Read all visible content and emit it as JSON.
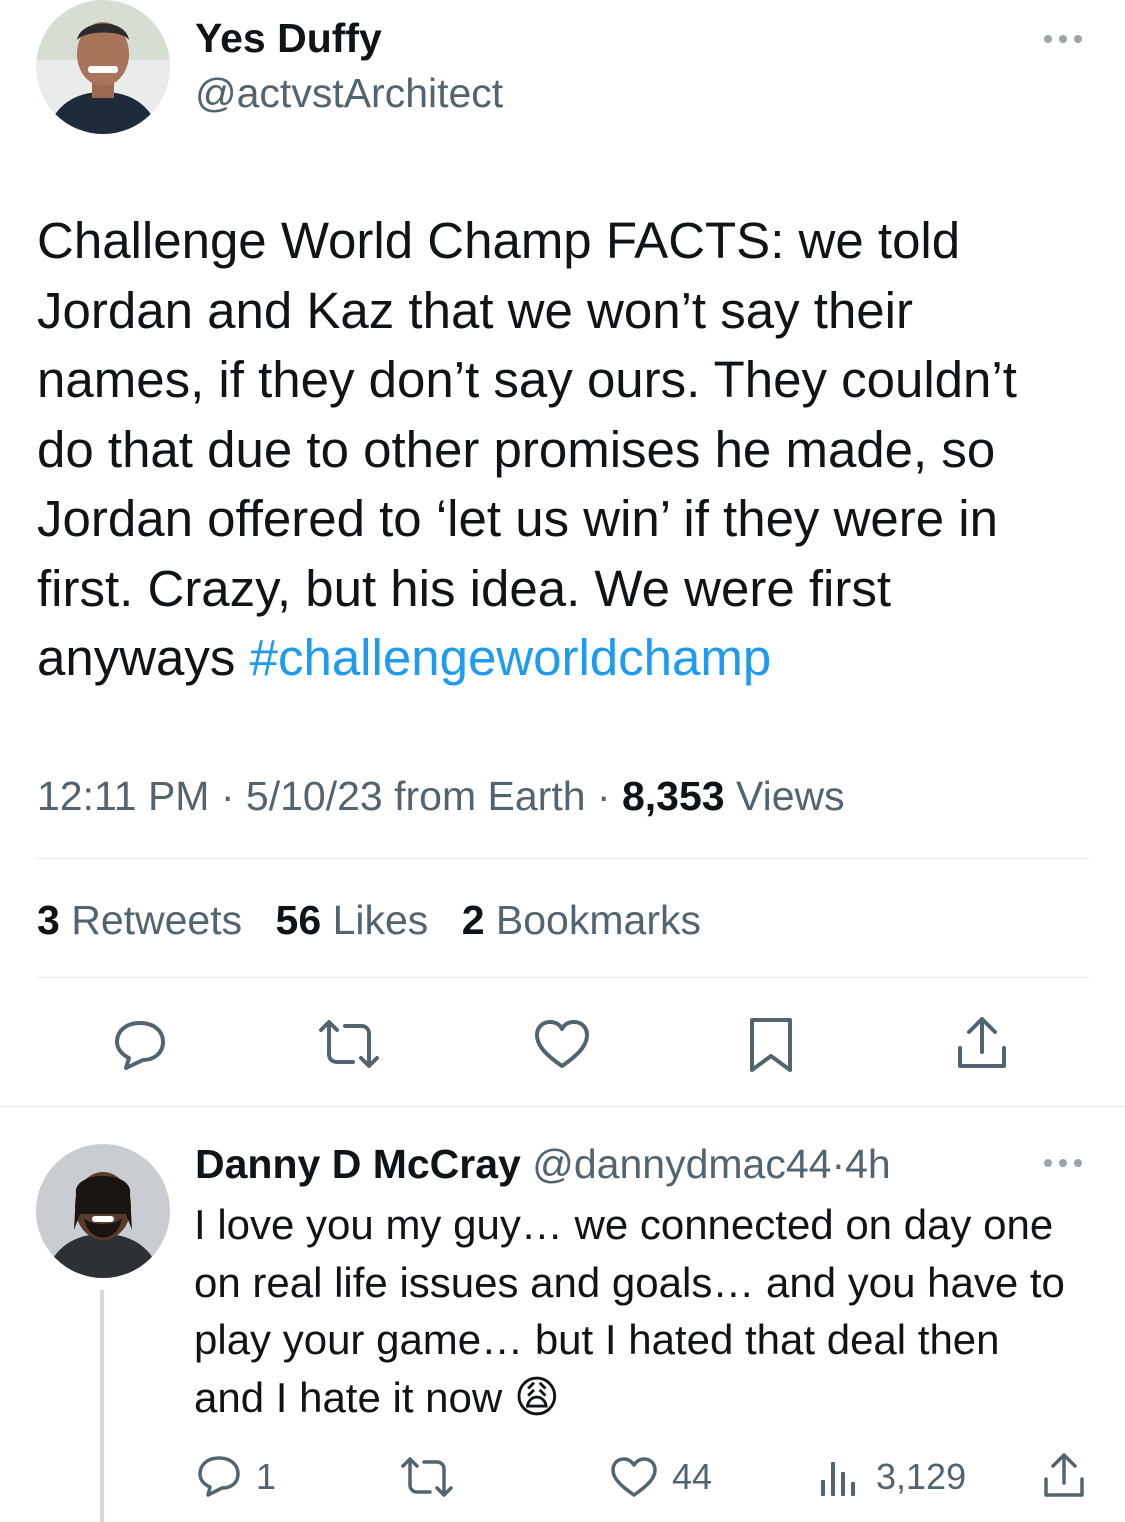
{
  "tweet": {
    "author_name": "Yes Duffy",
    "author_handle": "@actvstArchitect",
    "text_main": "Challenge World Champ FACTS: we told Jordan and Kaz that we won’t say their names, if they don’t say ours. They couldn’t do that due to other promises he made, so Jordan offered to ‘let us win’ if they were in first. Crazy, but his idea. We were first anyways",
    "hashtag": "#challengeworldchamp",
    "time": "12:11 PM",
    "date": "5/10/23",
    "source": "from Earth",
    "views_count": "8,353",
    "views_label": "Views",
    "retweets_count": "3",
    "retweets_label": "Retweets",
    "likes_count": "56",
    "likes_label": "Likes",
    "bookmarks_count": "2",
    "bookmarks_label": "Bookmarks",
    "sep": "·"
  },
  "reply": {
    "author_name": "Danny D McCray",
    "author_handle": "@dannydmac44",
    "age": "4h",
    "sep": "·",
    "text": "I love you my guy… we connected on day one on real life issues and goals… and you have to play your game… but I hated that deal then and I hate it now",
    "emoji": "😩",
    "replies": "1",
    "likes": "44",
    "views": "3,129"
  },
  "icons": {
    "more": "more-icon",
    "reply": "reply-icon",
    "retweet": "retweet-icon",
    "like": "heart-icon",
    "bookmark": "bookmark-icon",
    "share": "share-icon",
    "views": "views-icon"
  },
  "colors": {
    "text": "#0f1419",
    "muted": "#536471",
    "link": "#1d9bf0",
    "divider": "#e6e9eb"
  }
}
